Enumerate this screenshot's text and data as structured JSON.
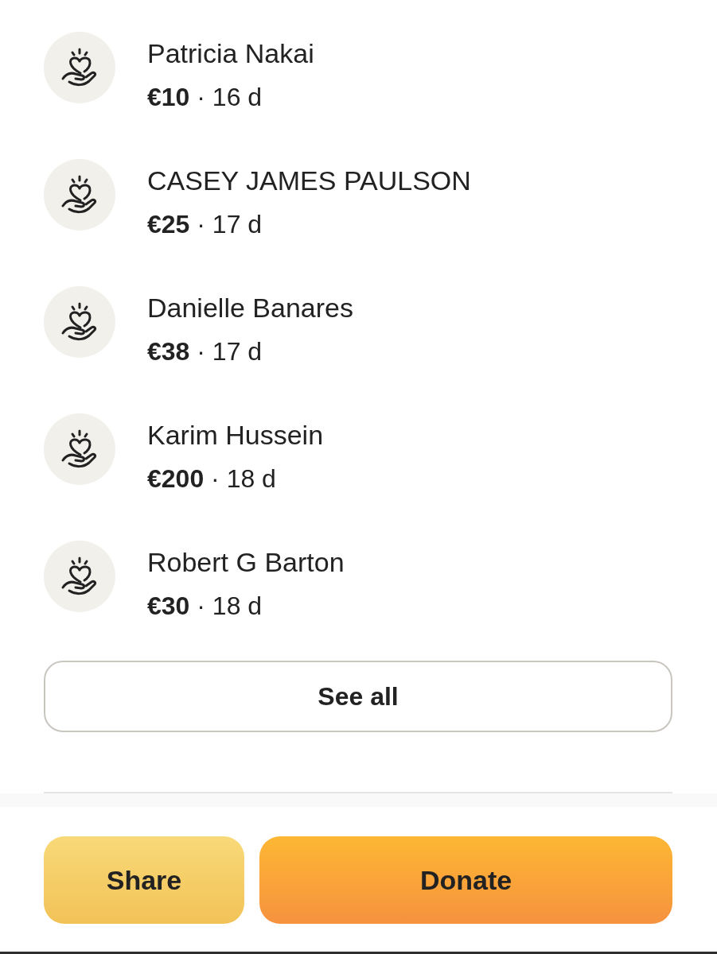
{
  "donations": [
    {
      "name": "Patricia Nakai",
      "detail": "**€10** · 16 d"
    },
    {
      "name": "CASEY JAMES PAULSON",
      "detail": "**€25** · 17 d"
    },
    {
      "name": "Danielle Banares",
      "detail": "**€38** · 17 d"
    },
    {
      "name": "Karim Hussein",
      "detail": "**€200** · 18 d"
    },
    {
      "name": "Robert G Barton",
      "detail": "**€30** · 18 d"
    }
  ],
  "see_all_button": {
    "label": "See all"
  },
  "actions": [
    {
      "label": "Share",
      "kind": "secondary"
    },
    {
      "label": "Donate",
      "kind": "primary"
    }
  ]
}
